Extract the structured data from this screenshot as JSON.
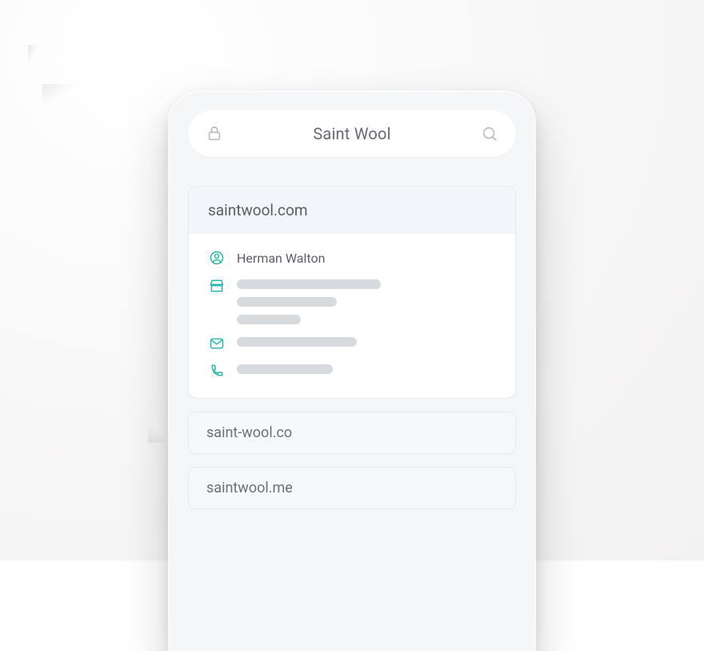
{
  "search": {
    "title": "Saint Wool"
  },
  "card": {
    "domain": "saintwool.com",
    "owner": "Herman Walton"
  },
  "alternates": [
    "saint-wool.co",
    "saintwool.me"
  ]
}
